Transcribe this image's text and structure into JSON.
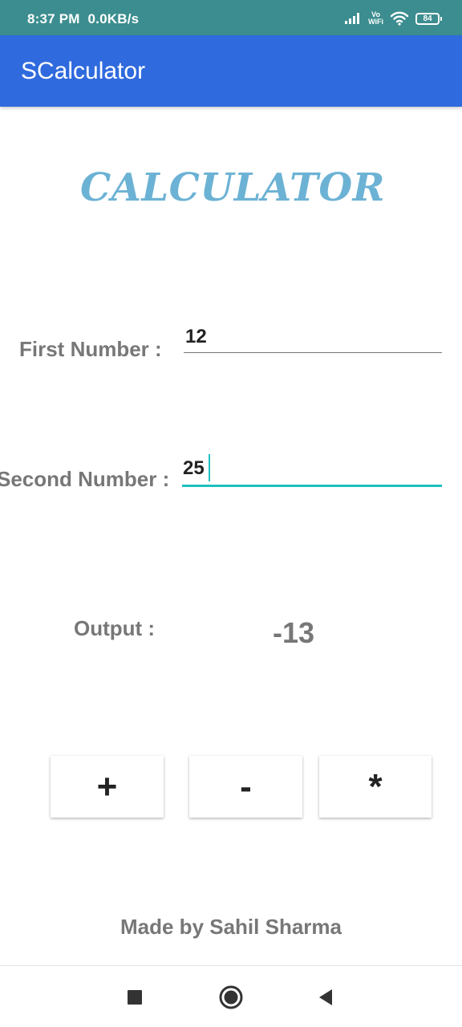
{
  "status_bar": {
    "time": "8:37 PM",
    "network_speed": "0.0KB/s",
    "vowifi_top": "Vo",
    "vowifi_bottom": "WiFi",
    "battery": "84"
  },
  "app_bar": {
    "title": "SCalculator"
  },
  "heading": "CALCULATOR",
  "first_number": {
    "label": "First Number :",
    "value": "12"
  },
  "second_number": {
    "label": "Second Number :",
    "value": "25"
  },
  "output": {
    "label": "Output :",
    "value": "-13"
  },
  "operations": [
    {
      "label": "+",
      "name": "add"
    },
    {
      "label": "-",
      "name": "subtract"
    },
    {
      "label": "*",
      "name": "multiply"
    }
  ],
  "credit": "Made by Sahil Sharma",
  "nav": {
    "icons": [
      "recent-apps-icon",
      "home-icon",
      "back-icon"
    ]
  },
  "colors": {
    "status_bar": "#3c8d8f",
    "app_bar": "#2f6ade",
    "heading": "#6cb2d4",
    "focus_accent": "#20c0c0",
    "label_gray": "#777777"
  }
}
